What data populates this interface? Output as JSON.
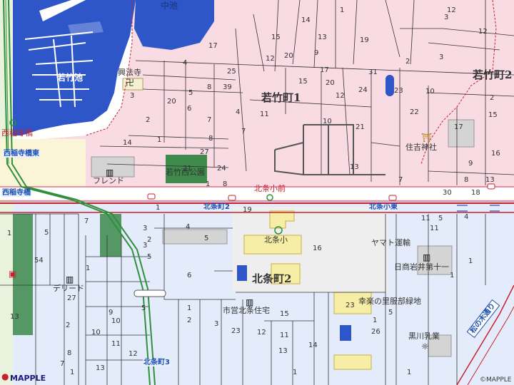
{
  "map": {
    "districts": {
      "wakatake1": "若竹町1",
      "wakatake2": "若竹町2",
      "hojo2": "北条町2"
    },
    "water": {
      "wakatake_pond": "若竹池",
      "naka_pond": "中池"
    },
    "facilities": {
      "kohoji": "興法寺",
      "wakatake_nishi_park": "若竹西公園",
      "friend": "フレンド",
      "sumiyoshi_shrine": "住吉神社",
      "hojo_elem": "北条小",
      "yamato": "ヤマト運輸",
      "nissho_iwai": "日商岩井第十一",
      "deport": "デリード",
      "shiei_hojo": "市営北条住宅",
      "kouraku": "幸楽の里服部緑地",
      "kurokawa": "黒川乳業"
    },
    "stops": {
      "nishi_kirishashi": "西稲寺橋",
      "nishi_kirishashi_east": "西稲寺橋東",
      "nishi_kirishashi_2": "西稲寺橋",
      "hojo_sho_mae": "北条小前",
      "hojo2": "北条町2",
      "hojo_sho_east": "北条小東",
      "hojo3": "北条町3"
    },
    "roads": {
      "matsunoki": "松の木通り"
    },
    "blocks": {
      "b_14a": "14",
      "b_1a": "1",
      "b_13a": "13",
      "b_15a": "15",
      "b_17a": "17",
      "b_12a": "12",
      "b_20a": "20",
      "b_19a": "19",
      "b_9a": "9",
      "b_2a": "2",
      "b_3a": "3",
      "b_3b": "3",
      "b_4a": "4",
      "b_25": "25",
      "b_5a": "5",
      "b_8a": "8",
      "b_39": "39",
      "b_20b": "20",
      "b_6a": "6",
      "b_2b": "2",
      "b_7a": "7",
      "b_7b": "7",
      "b_14b": "14",
      "b_1b": "1",
      "b_27a": "27",
      "b_24a": "24",
      "b_8b": "8",
      "b_4b": "4",
      "b_11a": "11",
      "b_15b": "15",
      "b_17b": "17",
      "b_20c": "20",
      "b_31": "31",
      "b_24b": "24",
      "b_23a": "23",
      "b_10a": "10",
      "b_2c": "2",
      "b_22": "22",
      "b_12b": "12",
      "b_10b": "10",
      "b_21": "21",
      "b_13b": "13",
      "b_17c": "17",
      "b_15c": "15",
      "b_16a": "16",
      "b_9b": "9",
      "b_8c": "8",
      "b_13c": "13",
      "b_30": "30",
      "b_18": "18",
      "b_3c": "3",
      "b_12c": "12",
      "b_12d": "12",
      "b_21b": "21",
      "b_1c": "1",
      "b_7c": "7",
      "b_8d": "8",
      "b_4c": "4",
      "b_5b": "5",
      "b_1d": "1",
      "b_2d": "2",
      "b_3d": "3",
      "b_5c": "5",
      "b_6b": "6",
      "b_19b": "19",
      "b_1e": "1",
      "b_16b": "16",
      "b_54": "54",
      "b_11b": "11",
      "b_5d": "5",
      "b_8e": "8",
      "b_10c": "10",
      "b_13d": "13",
      "b_12e": "12",
      "b_11c": "11",
      "b_10d": "10",
      "b_9c": "9",
      "b_2e": "2",
      "b_1f": "1",
      "b_3e": "3",
      "b_23b": "23",
      "b_15d": "15",
      "b_12f": "12",
      "b_11d": "11",
      "b_13e": "13",
      "b_14c": "14",
      "b_23c": "23",
      "b_26": "26",
      "b_1g": "1",
      "b_5e": "5",
      "b_1h": "1",
      "b_7d": "7",
      "b_3f": "3",
      "b_1i": "1",
      "b_27b": "27",
      "b_13f": "13",
      "b_11e": "11",
      "b_4d": "4",
      "b_5f": "5",
      "b_1j": "1",
      "b_1k": "1",
      "b_5g": "5",
      "b_1l": "1",
      "b_1m": "1",
      "b_2f": "2",
      "b_7e": "7"
    },
    "brand": "MAPPLE",
    "copyright": "©MAPPLE",
    "colors": {
      "pink_area": "#f9dbe4",
      "blue_area": "#e4ecfb",
      "water": "#2f56c8",
      "park": "#3d8a4a",
      "rail": "#2f8f3c",
      "main_road": "#c8202c"
    }
  }
}
